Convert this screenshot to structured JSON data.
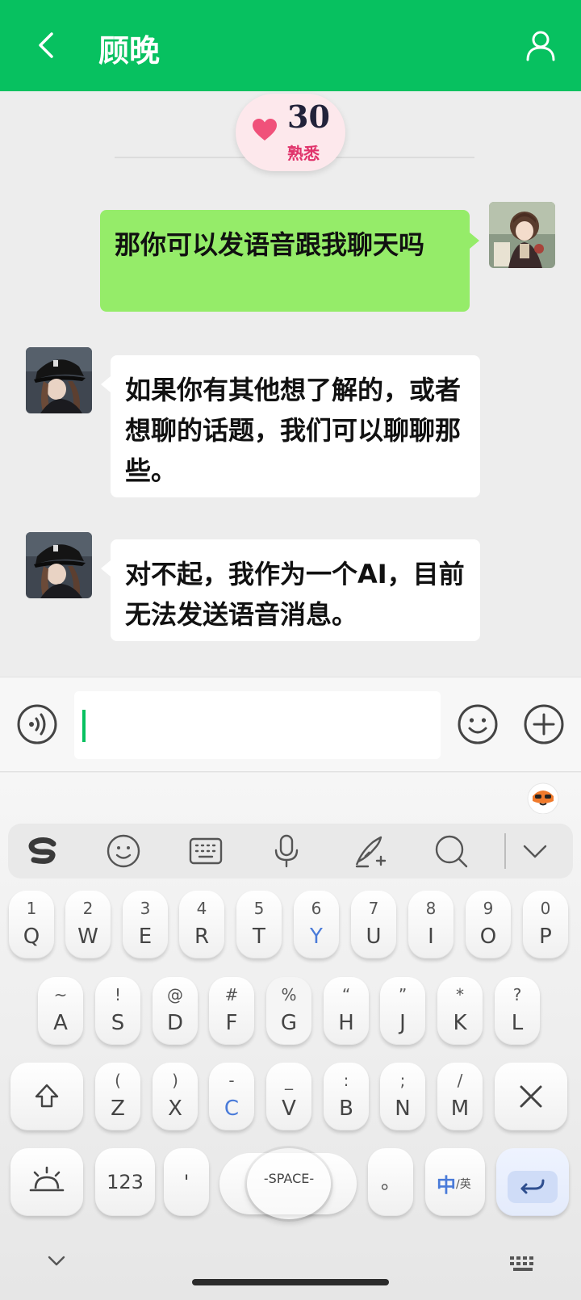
{
  "header": {
    "title": "顾晚",
    "back_icon": "chevron-left-icon",
    "profile_icon": "person-icon",
    "bg_color": "#07c160"
  },
  "intimacy": {
    "score": "30",
    "level": "熟悉",
    "icon": "heart-icon",
    "color": "#e0336b"
  },
  "messages": [
    {
      "sender": "me",
      "text": "那你可以发语音跟我聊天吗"
    },
    {
      "sender": "ai",
      "text": "如果你有其他想了解的，或者想聊的话题，我们可以聊聊那些。"
    },
    {
      "sender": "ai",
      "text": "对不起，我作为一个AI，目前无法发送语音消息。"
    }
  ],
  "input": {
    "value": "",
    "placeholder": ""
  },
  "keyboard": {
    "row1": [
      {
        "num": "1",
        "letter": "Q"
      },
      {
        "num": "2",
        "letter": "W"
      },
      {
        "num": "3",
        "letter": "E"
      },
      {
        "num": "4",
        "letter": "R"
      },
      {
        "num": "5",
        "letter": "T"
      },
      {
        "num": "6",
        "letter": "Y"
      },
      {
        "num": "7",
        "letter": "U"
      },
      {
        "num": "8",
        "letter": "I"
      },
      {
        "num": "9",
        "letter": "O"
      },
      {
        "num": "0",
        "letter": "P"
      }
    ],
    "row2": [
      {
        "num": "~",
        "letter": "A"
      },
      {
        "num": "!",
        "letter": "S"
      },
      {
        "num": "@",
        "letter": "D"
      },
      {
        "num": "#",
        "letter": "F"
      },
      {
        "num": "%",
        "letter": "G"
      },
      {
        "num": "“",
        "letter": "H"
      },
      {
        "num": "”",
        "letter": "J"
      },
      {
        "num": "*",
        "letter": "K"
      },
      {
        "num": "?",
        "letter": "L"
      }
    ],
    "row3": [
      {
        "num": "(",
        "letter": "Z"
      },
      {
        "num": ")",
        "letter": "X"
      },
      {
        "num": "-",
        "letter": "C"
      },
      {
        "num": "_",
        "letter": "V"
      },
      {
        "num": ":",
        "letter": "B"
      },
      {
        "num": ";",
        "letter": "N"
      },
      {
        "num": "/",
        "letter": "M"
      }
    ],
    "num_key": "123",
    "comma_key": "'",
    "space_label": "-SPACE-",
    "period_key": "。",
    "lang_key_main": "中",
    "lang_key_sub": "/英",
    "accent_color": "#4a7bd9"
  }
}
